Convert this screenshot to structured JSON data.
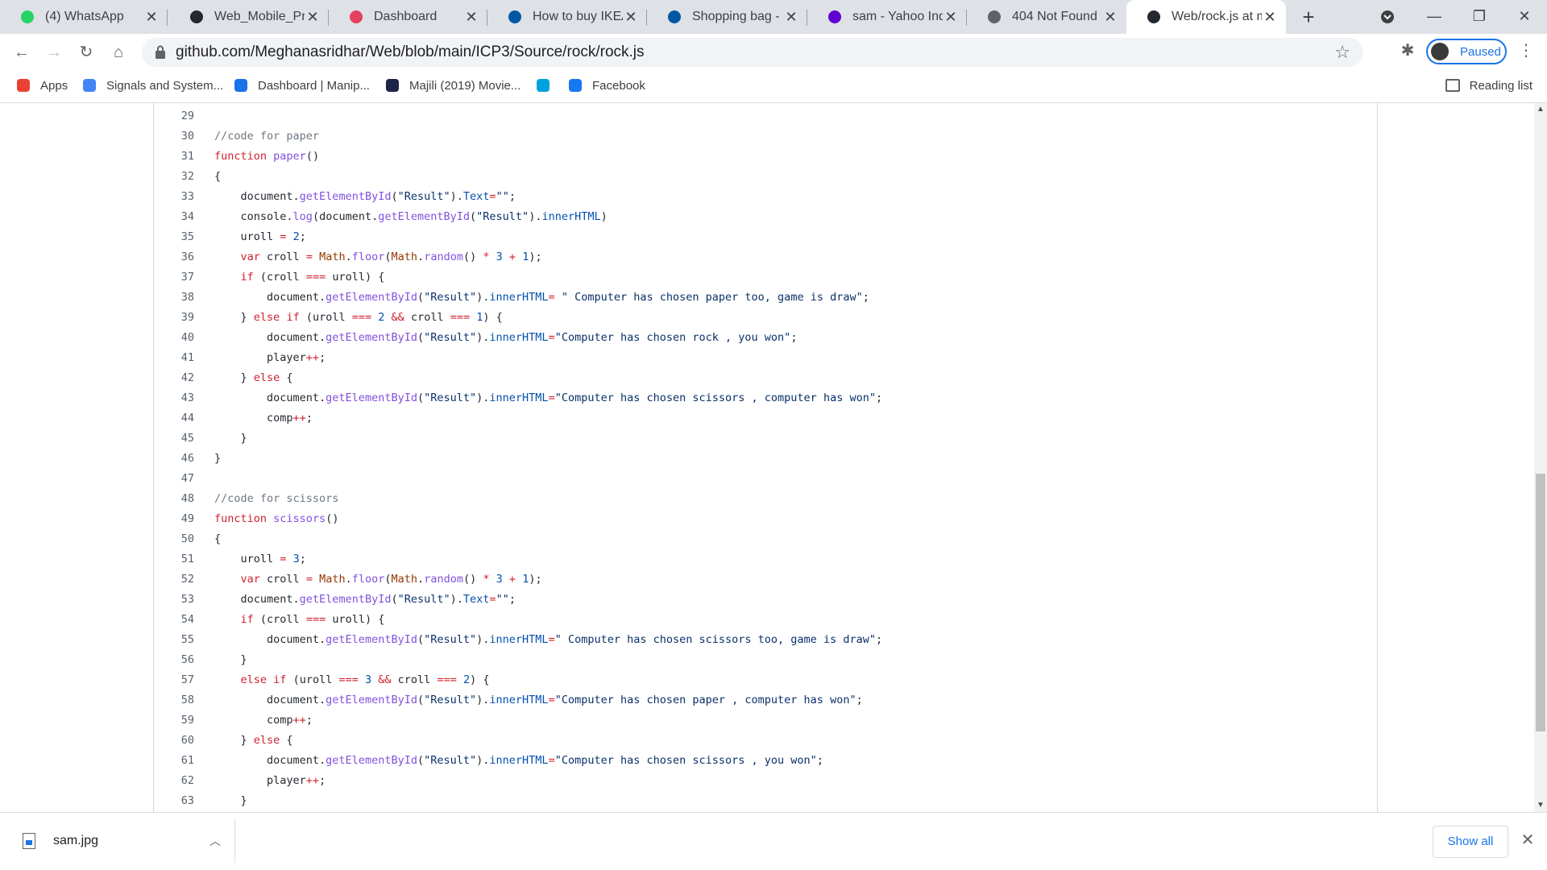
{
  "tabs": [
    {
      "title": "(4) WhatsApp",
      "icon": "whatsapp-icon",
      "color": "#25d366"
    },
    {
      "title": "Web_Mobile_Prog",
      "icon": "github-icon",
      "color": "#24292f"
    },
    {
      "title": "Dashboard",
      "icon": "dashboard-icon",
      "color": "#e4405f"
    },
    {
      "title": "How to buy IKEA",
      "icon": "ikea-icon",
      "color": "#0058a3"
    },
    {
      "title": "Shopping bag - Ik",
      "icon": "ikea-icon",
      "color": "#0058a3"
    },
    {
      "title": "sam - Yahoo India",
      "icon": "yahoo-icon",
      "color": "#6001d2"
    },
    {
      "title": "404 Not Found",
      "icon": "globe-icon",
      "color": "#5f6368"
    },
    {
      "title": "Web/rock.js at ma",
      "icon": "github-icon",
      "color": "#24292f",
      "active": true
    }
  ],
  "url": "github.com/Meghanasridhar/Web/blob/main/ICP3/Source/rock/rock.js",
  "profile": {
    "label": "Paused"
  },
  "bookmarks": [
    {
      "label": "Apps",
      "icon": "apps-grid-icon"
    },
    {
      "label": "Signals and System...",
      "icon": "google-icon"
    },
    {
      "label": "Dashboard | Manip...",
      "icon": "cloud-icon"
    },
    {
      "label": "Majili (2019) Movie...",
      "icon": "movie-icon"
    },
    {
      "label": "",
      "icon": "circle-logo-icon"
    },
    {
      "label": "Facebook",
      "icon": "facebook-icon"
    }
  ],
  "reading_list": "Reading list",
  "code_lines": [
    {
      "n": "29",
      "html": ""
    },
    {
      "n": "30",
      "html": "<span class='c'>//code for paper</span>"
    },
    {
      "n": "31",
      "html": "<span class='k'>function</span> <span class='f'>paper</span>()"
    },
    {
      "n": "32",
      "html": "{"
    },
    {
      "n": "33",
      "html": "    document.<span class='f'>getElementById</span>(<span class='s'>\"Result\"</span>).<span class='n'>Text</span><span class='k'>=</span><span class='s'>\"\"</span>;"
    },
    {
      "n": "34",
      "html": "    console.<span class='f'>log</span>(document.<span class='f'>getElementById</span>(<span class='s'>\"Result\"</span>).<span class='n'>innerHTML</span>)"
    },
    {
      "n": "35",
      "html": "    uroll <span class='k'>=</span> <span class='n'>2</span>;"
    },
    {
      "n": "36",
      "html": "    <span class='k'>var</span> croll <span class='k'>=</span> <span class='m'>Math</span>.<span class='f'>floor</span>(<span class='m'>Math</span>.<span class='f'>random</span>() <span class='k'>*</span> <span class='n'>3</span> <span class='k'>+</span> <span class='n'>1</span>);"
    },
    {
      "n": "37",
      "html": "    <span class='k'>if</span> (croll <span class='k'>===</span> uroll) {"
    },
    {
      "n": "38",
      "html": "        document.<span class='f'>getElementById</span>(<span class='s'>\"Result\"</span>).<span class='n'>innerHTML</span><span class='k'>=</span> <span class='s'>\" Computer has chosen paper too, game is draw\"</span>;"
    },
    {
      "n": "39",
      "html": "    } <span class='k'>else</span> <span class='k'>if</span> (uroll <span class='k'>===</span> <span class='n'>2</span> <span class='k'>&amp;&amp;</span> croll <span class='k'>===</span> <span class='n'>1</span>) {"
    },
    {
      "n": "40",
      "html": "        document.<span class='f'>getElementById</span>(<span class='s'>\"Result\"</span>).<span class='n'>innerHTML</span><span class='k'>=</span><span class='s'>\"Computer has chosen rock , you won\"</span>;"
    },
    {
      "n": "41",
      "html": "        player<span class='k'>++</span>;"
    },
    {
      "n": "42",
      "html": "    } <span class='k'>else</span> {"
    },
    {
      "n": "43",
      "html": "        document.<span class='f'>getElementById</span>(<span class='s'>\"Result\"</span>).<span class='n'>innerHTML</span><span class='k'>=</span><span class='s'>\"Computer has chosen scissors , computer has won\"</span>;"
    },
    {
      "n": "44",
      "html": "        comp<span class='k'>++</span>;"
    },
    {
      "n": "45",
      "html": "    }"
    },
    {
      "n": "46",
      "html": "}"
    },
    {
      "n": "47",
      "html": ""
    },
    {
      "n": "48",
      "html": "<span class='c'>//code for scissors</span>"
    },
    {
      "n": "49",
      "html": "<span class='k'>function</span> <span class='f'>scissors</span>()"
    },
    {
      "n": "50",
      "html": "{"
    },
    {
      "n": "51",
      "html": "    uroll <span class='k'>=</span> <span class='n'>3</span>;"
    },
    {
      "n": "52",
      "html": "    <span class='k'>var</span> croll <span class='k'>=</span> <span class='m'>Math</span>.<span class='f'>floor</span>(<span class='m'>Math</span>.<span class='f'>random</span>() <span class='k'>*</span> <span class='n'>3</span> <span class='k'>+</span> <span class='n'>1</span>);"
    },
    {
      "n": "53",
      "html": "    document.<span class='f'>getElementById</span>(<span class='s'>\"Result\"</span>).<span class='n'>Text</span><span class='k'>=</span><span class='s'>\"\"</span>;"
    },
    {
      "n": "54",
      "html": "    <span class='k'>if</span> (croll <span class='k'>===</span> uroll) {"
    },
    {
      "n": "55",
      "html": "        document.<span class='f'>getElementById</span>(<span class='s'>\"Result\"</span>).<span class='n'>innerHTML</span><span class='k'>=</span><span class='s'>\" Computer has chosen scissors too, game is draw\"</span>;"
    },
    {
      "n": "56",
      "html": "    }"
    },
    {
      "n": "57",
      "html": "    <span class='k'>else</span> <span class='k'>if</span> (uroll <span class='k'>===</span> <span class='n'>3</span> <span class='k'>&amp;&amp;</span> croll <span class='k'>===</span> <span class='n'>2</span>) {"
    },
    {
      "n": "58",
      "html": "        document.<span class='f'>getElementById</span>(<span class='s'>\"Result\"</span>).<span class='n'>innerHTML</span><span class='k'>=</span><span class='s'>\"Computer has chosen paper , computer has won\"</span>;"
    },
    {
      "n": "59",
      "html": "        comp<span class='k'>++</span>;"
    },
    {
      "n": "60",
      "html": "    } <span class='k'>else</span> {"
    },
    {
      "n": "61",
      "html": "        document.<span class='f'>getElementById</span>(<span class='s'>\"Result\"</span>).<span class='n'>innerHTML</span><span class='k'>=</span><span class='s'>\"Computer has chosen scissors , you won\"</span>;"
    },
    {
      "n": "62",
      "html": "        player<span class='k'>++</span>;"
    },
    {
      "n": "63",
      "html": "    }"
    }
  ],
  "download": {
    "filename": "sam.jpg",
    "show_all": "Show all"
  }
}
